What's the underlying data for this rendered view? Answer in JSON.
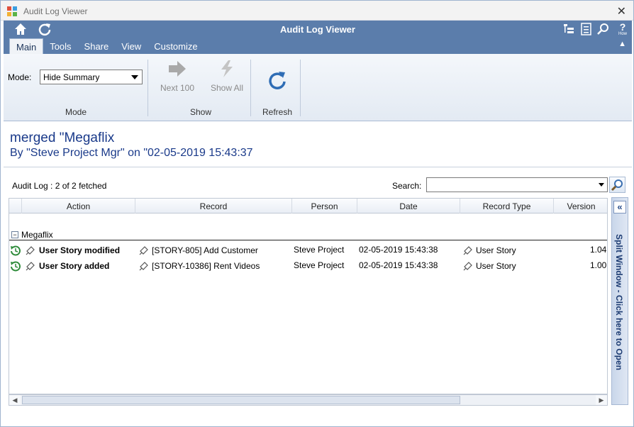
{
  "window": {
    "title": "Audit Log Viewer",
    "close_glyph": "✕"
  },
  "ribbon": {
    "title": "Audit Log Viewer",
    "tabs": [
      {
        "label": "Main",
        "active": true
      },
      {
        "label": "Tools",
        "active": false
      },
      {
        "label": "Share",
        "active": false
      },
      {
        "label": "View",
        "active": false
      },
      {
        "label": "Customize",
        "active": false
      }
    ],
    "help_label": "How",
    "groups": {
      "mode": {
        "label": "Mode",
        "field_label": "Mode:",
        "selected": "Hide Summary"
      },
      "show": {
        "label": "Show",
        "next_label": "Next 100",
        "show_all_label": "Show All"
      },
      "refresh": {
        "label": "Refresh"
      }
    }
  },
  "header": {
    "title": "merged \"Megaflix",
    "subtitle": "By \"Steve Project Mgr\" on \"02-05-2019 15:43:37"
  },
  "audit_log": {
    "count_label": "Audit Log : 2 of 2 fetched",
    "search_label": "Search:",
    "search_value": "",
    "columns": [
      "Action",
      "Record",
      "Person",
      "Date",
      "Record Type",
      "Version"
    ],
    "group_name": "Megaflix",
    "rows": [
      {
        "action": "User Story modified",
        "record": "[STORY-805] Add Customer",
        "person": "Steve Project",
        "date": "02-05-2019 15:43:38",
        "record_type": "User Story",
        "version": "1.04"
      },
      {
        "action": "User Story added",
        "record": "[STORY-10386] Rent Videos",
        "person": "Steve Project",
        "date": "02-05-2019 15:43:38",
        "record_type": "User Story",
        "version": "1.00"
      }
    ]
  },
  "split_window": {
    "label": "Split Window - Click here to Open",
    "button_glyph": "«"
  },
  "icons": {
    "history": "history-icon",
    "story": "story-icon"
  },
  "colors": {
    "ribbon_blue": "#5b7dab",
    "header_text": "#1a3a8a",
    "history_green": "#2e8b3a"
  }
}
